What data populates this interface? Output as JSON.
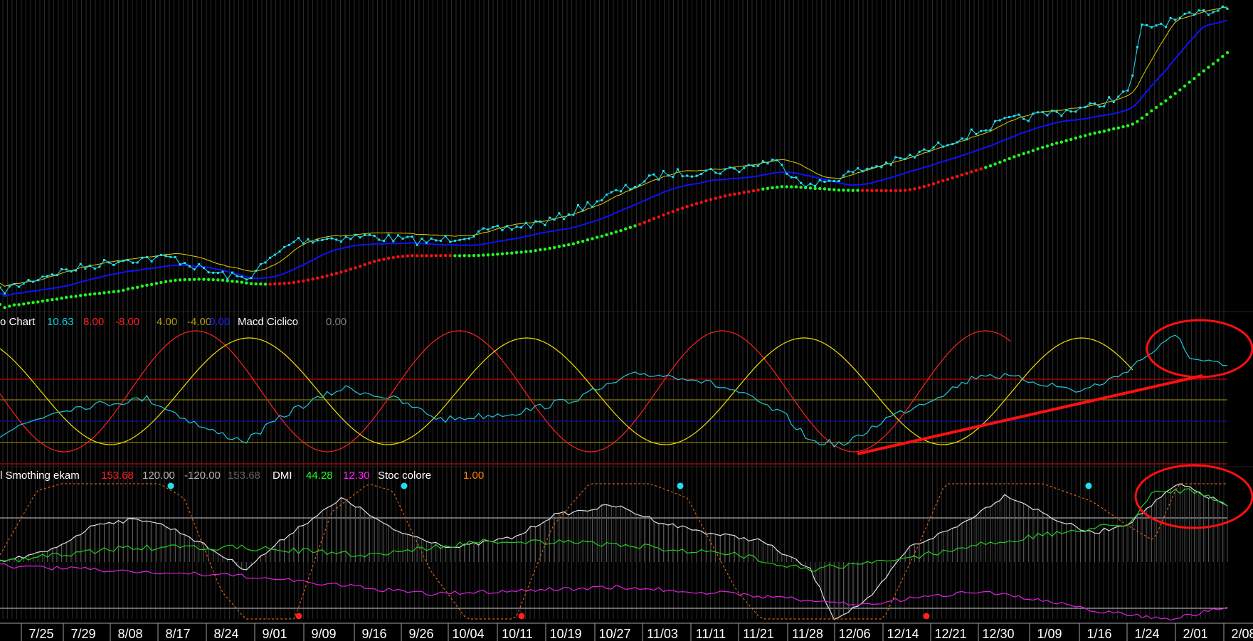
{
  "chart_data": [
    {
      "type": "line",
      "panel": "price",
      "description_series": [
        "price",
        "blue moving average",
        "yellow moving average",
        "green/red moving average"
      ],
      "trend": "rising from lower-left to upper-right"
    },
    {
      "type": "line",
      "panel": "macd",
      "legend": [
        {
          "text": "o Chart",
          "color": "#ffffff"
        },
        {
          "text": "10.63",
          "color": "#00d8e8"
        },
        {
          "text": "8.00",
          "color": "#ff2020"
        },
        {
          "text": "-8.00",
          "color": "#ff2020"
        },
        {
          "text": "4.00",
          "color": "#b09a00"
        },
        {
          "text": "-4.00",
          "color": "#b09a00"
        },
        {
          "text": "0.00",
          "color": "#2020ff"
        },
        {
          "text": "Macd Ciclico",
          "color": "#ffffff"
        },
        {
          "text": "0.00",
          "color": "#808080"
        }
      ],
      "hlines": [
        8.0,
        4.0,
        0.0,
        -4.0,
        -8.0
      ]
    },
    {
      "type": "line",
      "panel": "oscillator",
      "legend": [
        {
          "text": "l Smothing ekam",
          "color": "#ffffff"
        },
        {
          "text": "153.68",
          "color": "#ff2020"
        },
        {
          "text": "120.00",
          "color": "#b0b0b0"
        },
        {
          "text": "-120.00",
          "color": "#b0b0b0"
        },
        {
          "text": "153.68",
          "color": "#606060"
        },
        {
          "text": "DMI",
          "color": "#ffffff"
        },
        {
          "text": "44.28",
          "color": "#20ff20"
        },
        {
          "text": "12.30",
          "color": "#ff20ff"
        },
        {
          "text": "Stoc colore",
          "color": "#ffffff"
        },
        {
          "text": "1.00",
          "color": "#ff8000"
        }
      ]
    }
  ],
  "x_axis": {
    "labels": [
      "7/25",
      "7/29",
      "8/08",
      "8/17",
      "8/24",
      "9/01",
      "9/09",
      "9/16",
      "9/26",
      "10/04",
      "10/11",
      "10/19",
      "10/27",
      "11/03",
      "11/11",
      "11/21",
      "11/28",
      "12/06",
      "12/14",
      "12/21",
      "12/30",
      "1/09",
      "1/16",
      "1/24",
      "2/01",
      "2/08"
    ]
  },
  "colors": {
    "background": "#000000",
    "price": "#20e0f0",
    "ma_blue": "#1010ff",
    "ma_yellow": "#e0d000",
    "ma_green": "#20ff20",
    "ma_red": "#ff1010",
    "annotation": "#ff1010"
  }
}
